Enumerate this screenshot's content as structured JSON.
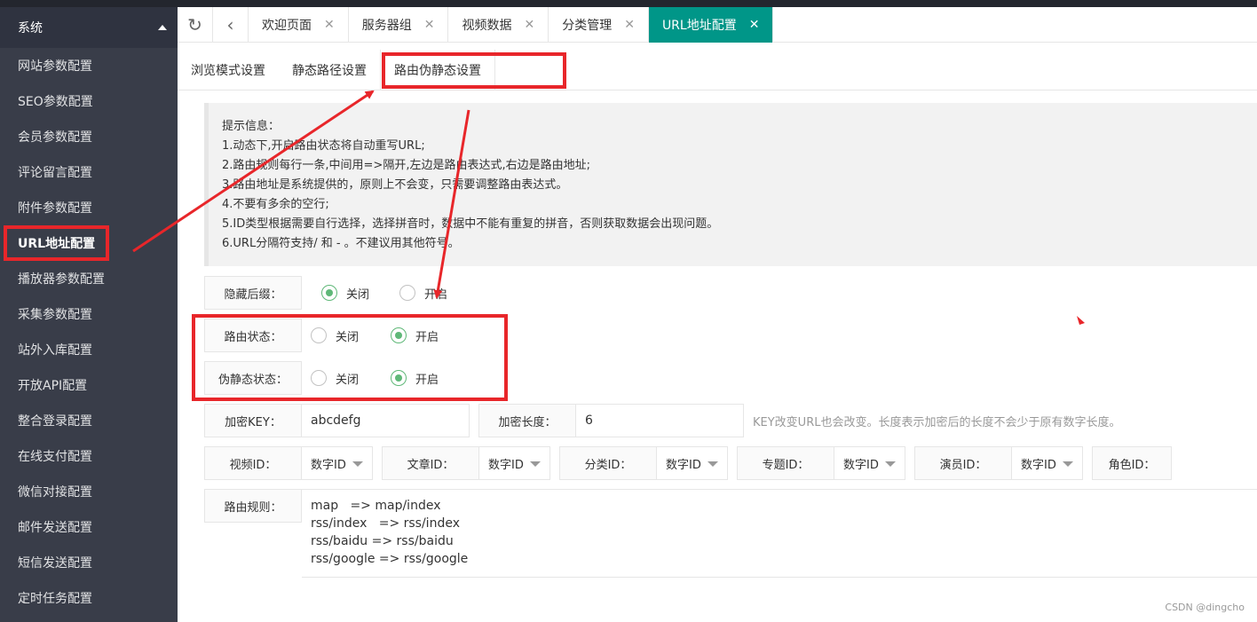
{
  "sidebar": {
    "group": "系统",
    "items": [
      {
        "label": "网站参数配置"
      },
      {
        "label": "SEO参数配置"
      },
      {
        "label": "会员参数配置"
      },
      {
        "label": "评论留言配置"
      },
      {
        "label": "附件参数配置"
      },
      {
        "label": "URL地址配置"
      },
      {
        "label": "播放器参数配置"
      },
      {
        "label": "采集参数配置"
      },
      {
        "label": "站外入库配置"
      },
      {
        "label": "开放API配置"
      },
      {
        "label": "整合登录配置"
      },
      {
        "label": "在线支付配置"
      },
      {
        "label": "微信对接配置"
      },
      {
        "label": "邮件发送配置"
      },
      {
        "label": "短信发送配置"
      },
      {
        "label": "定时任务配置"
      }
    ]
  },
  "tabs": [
    {
      "label": "欢迎页面"
    },
    {
      "label": "服务器组"
    },
    {
      "label": "视频数据"
    },
    {
      "label": "分类管理"
    },
    {
      "label": "URL地址配置"
    }
  ],
  "subtabs": [
    {
      "label": "浏览模式设置"
    },
    {
      "label": "静态路径设置"
    },
    {
      "label": "路由伪静态设置"
    }
  ],
  "tips": {
    "title": "提示信息：",
    "lines": [
      "1.动态下,开启路由状态将自动重写URL;",
      "2.路由规则每行一条,中间用=>隔开,左边是路由表达式,右边是路由地址;",
      "3.路由地址是系统提供的，原则上不会变，只需要调整路由表达式。",
      "4.不要有多余的空行;",
      "5.ID类型根据需要自行选择，选择拼音时，数据中不能有重复的拼音，否则获取数据会出现问题。",
      "6.URL分隔符支持/ 和 - 。不建议用其他符号。"
    ]
  },
  "form": {
    "suffix": {
      "label": "隐藏后缀：",
      "off": "关闭",
      "on": "开启"
    },
    "route": {
      "label": "路由状态：",
      "off": "关闭",
      "on": "开启"
    },
    "rewrite": {
      "label": "伪静态状态：",
      "off": "关闭",
      "on": "开启"
    },
    "key": {
      "label": "加密KEY：",
      "value": "abcdefg"
    },
    "len": {
      "label": "加密长度：",
      "value": "6"
    },
    "key_hint": "KEY改变URL也会改变。长度表示加密后的长度不会少于原有数字长度。",
    "ids": [
      {
        "label": "视频ID：",
        "value": "数字ID"
      },
      {
        "label": "文章ID：",
        "value": "数字ID"
      },
      {
        "label": "分类ID：",
        "value": "数字ID"
      },
      {
        "label": "专题ID：",
        "value": "数字ID"
      },
      {
        "label": "演员ID：",
        "value": "数字ID"
      },
      {
        "label": "角色ID：",
        "value": ""
      }
    ],
    "rules": {
      "label": "路由规则：",
      "value": "map   => map/index\nrss/index   => rss/index\nrss/baidu => rss/baidu\nrss/google => rss/google"
    }
  },
  "watermark": "CSDN @dingcho",
  "colors": {
    "accent": "#009688",
    "annotation": "#e8262a",
    "radio_on": "#5fb878"
  }
}
